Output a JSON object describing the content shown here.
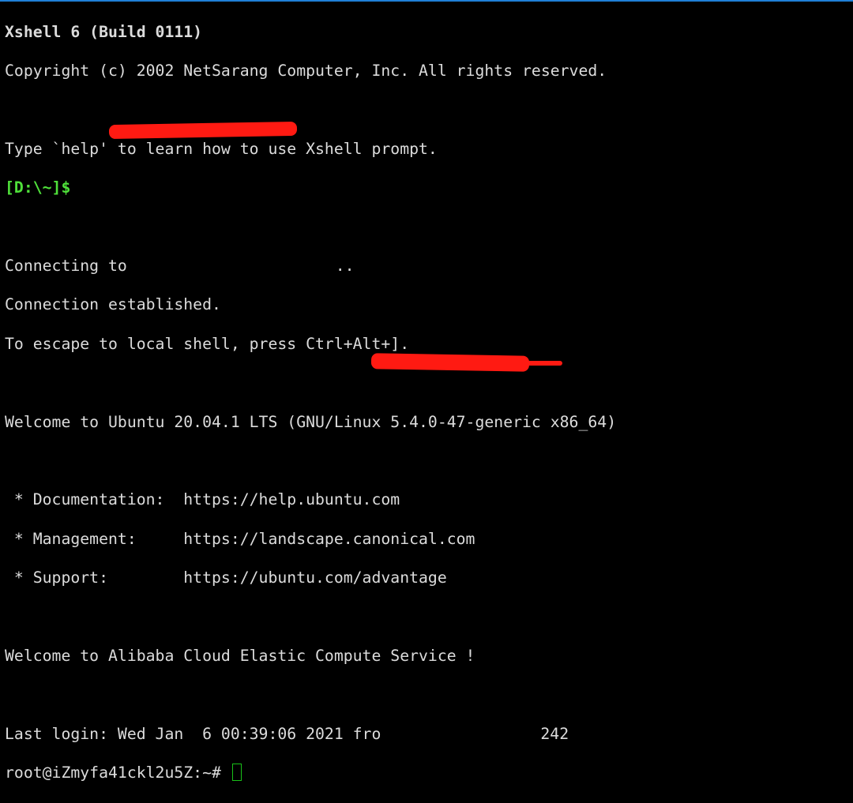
{
  "colors": {
    "background": "#000000",
    "text": "#dcdcdc",
    "prompt_local": "#4fe03a",
    "cursor": "#19c019",
    "redaction": "#ff1a12",
    "window_border": "#1f7fd6"
  },
  "lines": {
    "banner_title": "Xshell 6 (Build 0111)",
    "copyright": "Copyright (c) 2002 NetSarang Computer, Inc. All rights reserved.",
    "help_hint": "Type `help' to learn how to use Xshell prompt.",
    "local_prompt": "[D:\\~]$",
    "connecting_prefix": "Connecting to ",
    "connecting_suffix": "..",
    "established": "Connection established.",
    "escape_hint": "To escape to local shell, press Ctrl+Alt+].",
    "welcome_ubuntu": "Welcome to Ubuntu 20.04.1 LTS (GNU/Linux 5.4.0-47-generic x86_64)",
    "doc": " * Documentation:  https://help.ubuntu.com",
    "mgmt": " * Management:     https://landscape.canonical.com",
    "support": " * Support:        https://ubuntu.com/advantage",
    "welcome_alibaba": "Welcome to Alibaba Cloud Elastic Compute Service !",
    "last_login_prefix": "Last login: Wed Jan  6 00:39:06 2021 fro",
    "last_login_suffix": "242",
    "remote_prompt": "root@iZmyfa41ckl2u5Z:~# "
  }
}
